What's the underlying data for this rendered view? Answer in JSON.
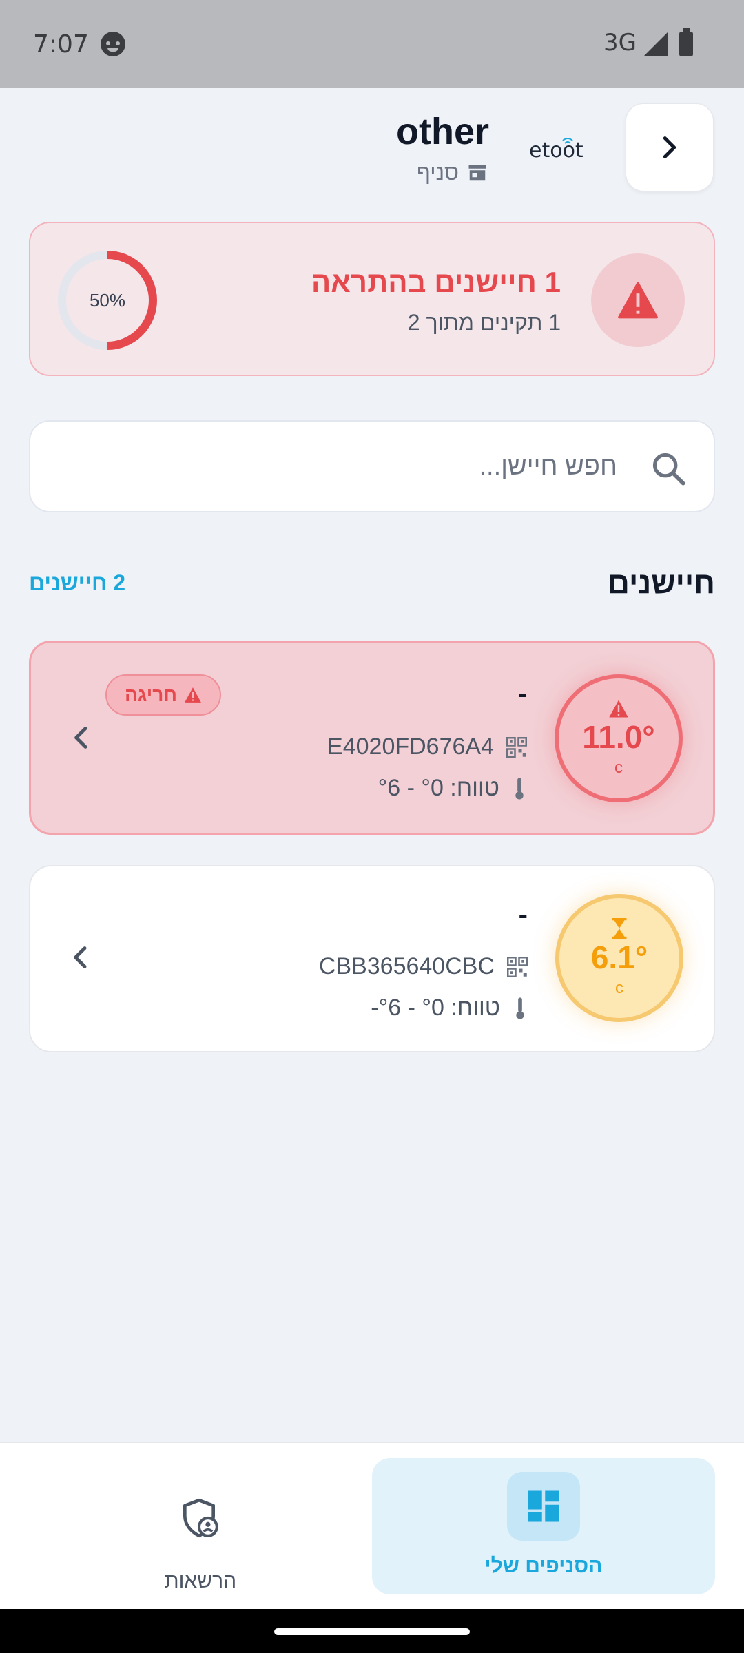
{
  "status_bar": {
    "time": "7:07",
    "network": "3G"
  },
  "header": {
    "title": "other",
    "subtitle": "סניף",
    "logo_text": "etoot"
  },
  "alert_summary": {
    "title": "1 חיישנים בהתראה",
    "subtitle": "1 תקינים מתוך 2",
    "percent_label": "50%",
    "percent_value": 50,
    "color": "#e5484d"
  },
  "search": {
    "placeholder": "חפש חיישן..."
  },
  "sensors_section": {
    "title": "חיישנים",
    "count_label": "2 חיישנים"
  },
  "sensors": [
    {
      "name": "-",
      "id": "E4020FD676A4",
      "range": "טווח: °0 - °6",
      "temperature": "11.0°",
      "unit": "c",
      "status_badge": "חריגה",
      "status": "alarm",
      "color": "#e5484d"
    },
    {
      "name": "-",
      "id": "CBB365640CBC",
      "range": "טווח: °0 - °6-",
      "temperature": "6.1°",
      "unit": "c",
      "status": "pending",
      "color": "#f59e0b"
    }
  ],
  "bottom_nav": {
    "items": [
      {
        "label": "הסניפים שלי",
        "icon": "dashboard-icon",
        "active": true
      },
      {
        "label": "הרשאות",
        "icon": "shield-user-icon",
        "active": false
      }
    ]
  }
}
